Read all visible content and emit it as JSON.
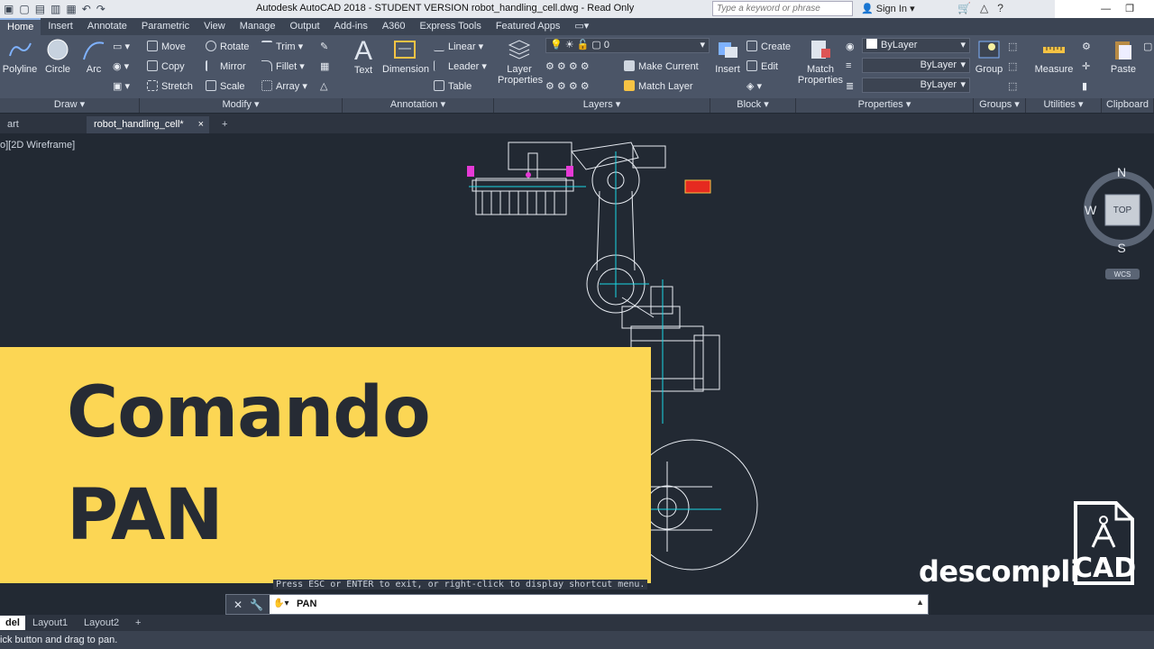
{
  "titlebar": {
    "title": "Autodesk AutoCAD 2018 - STUDENT VERSION    robot_handling_cell.dwg - Read Only",
    "search_placeholder": "Type a keyword or phrase",
    "signin": "Sign In"
  },
  "ribbon_tabs": [
    "Home",
    "Insert",
    "Annotate",
    "Parametric",
    "View",
    "Manage",
    "Output",
    "Add-ins",
    "A360",
    "Express Tools",
    "Featured Apps"
  ],
  "draw": {
    "polyline": "Polyline",
    "circle": "Circle",
    "arc": "Arc",
    "panel": "Draw"
  },
  "modify": {
    "move": "Move",
    "rotate": "Rotate",
    "trim": "Trim",
    "copy": "Copy",
    "mirror": "Mirror",
    "fillet": "Fillet",
    "stretch": "Stretch",
    "scale": "Scale",
    "array": "Array",
    "panel": "Modify"
  },
  "annotation": {
    "text": "Text",
    "dimension": "Dimension",
    "linear": "Linear",
    "leader": "Leader",
    "table": "Table",
    "panel": "Annotation"
  },
  "layers": {
    "layer_properties_1": "Layer",
    "layer_properties_2": "Properties",
    "current_layer": "0",
    "make_current": "Make Current",
    "match_layer": "Match Layer",
    "panel": "Layers"
  },
  "block": {
    "insert": "Insert",
    "create": "Create",
    "edit": "Edit",
    "panel": "Block"
  },
  "properties": {
    "match_1": "Match",
    "match_2": "Properties",
    "color": "ByLayer",
    "linetype": "ByLayer",
    "lineweight": "ByLayer",
    "panel": "Properties"
  },
  "groups": {
    "group": "Group",
    "panel": "Groups"
  },
  "utilities": {
    "measure": "Measure",
    "panel": "Utilities"
  },
  "clipboard": {
    "paste": "Paste",
    "panel": "Clipboard"
  },
  "file_tabs": {
    "start": "art",
    "drawing": "robot_handling_cell*",
    "add": "+"
  },
  "view_label": "o][2D Wireframe]",
  "viewcube": {
    "n": "N",
    "s": "S",
    "w": "W",
    "top": "TOP",
    "wcs": "WCS"
  },
  "banner": {
    "line1": "Comando",
    "line2": "PAN"
  },
  "command": {
    "hint": "Press ESC or ENTER to exit, or right-click to display shortcut menu.",
    "text": "PAN"
  },
  "layout_tabs": {
    "model": "del",
    "layout1": "Layout1",
    "layout2": "Layout2",
    "add": "+"
  },
  "status": "ick button and drag to pan.",
  "logo": {
    "word": "descompli",
    "cad": "CAD"
  }
}
